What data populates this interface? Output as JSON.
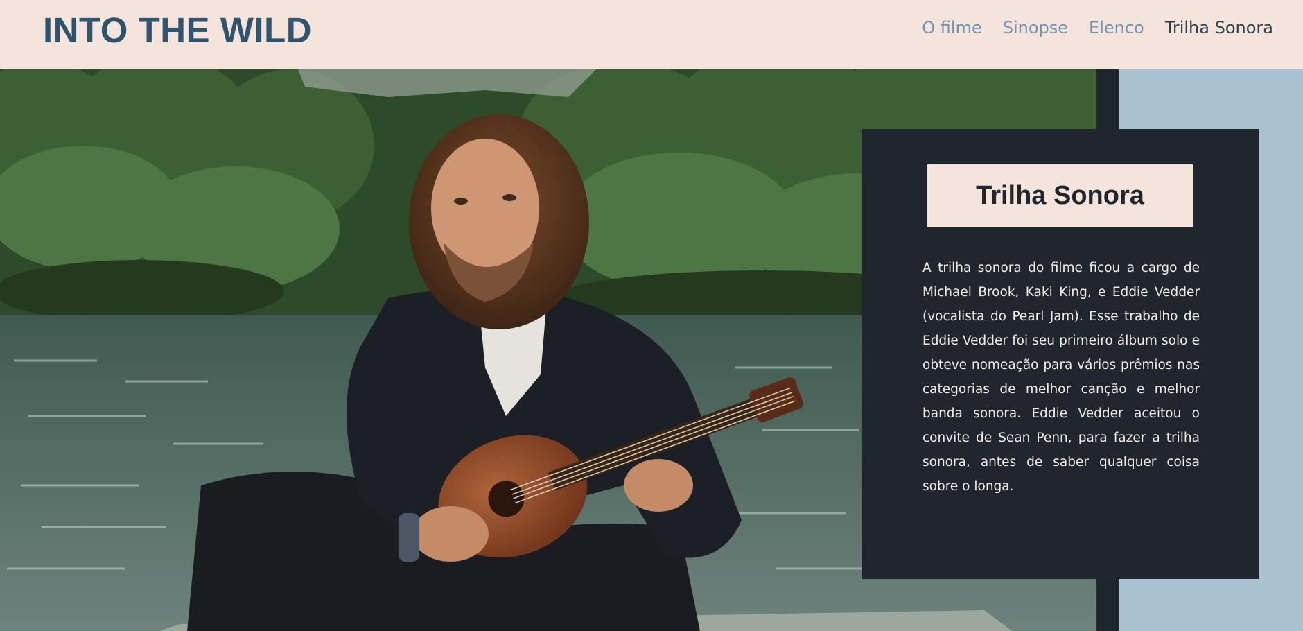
{
  "header": {
    "logo": "INTO THE WILD",
    "nav": [
      {
        "label": "O filme"
      },
      {
        "label": "Sinopse"
      },
      {
        "label": "Elenco"
      },
      {
        "label": "Trilha Sonora",
        "active": true
      }
    ]
  },
  "card": {
    "title": "Trilha Sonora",
    "text": "A trilha sonora do filme ficou a cargo de Michael Brook, Kaki King, e Eddie Vedder (vocalista do Pearl Jam). Esse trabalho de Eddie Vedder foi seu primeiro álbum solo e obteve nomeação para vários prêmios nas categorias de melhor canção e melhor banda sonora. Eddie Vedder aceitou o convite de Sean Penn, para fazer a trilha sonora, antes de saber qualquer coisa sobre o longa."
  },
  "colors": {
    "header_bg": "#f4e4dc",
    "logo": "#2f5470",
    "nav_link": "#6f94b4",
    "nav_active": "#2c4152",
    "card_bg": "#1f262d",
    "side_panel": "#a9c1d1"
  }
}
